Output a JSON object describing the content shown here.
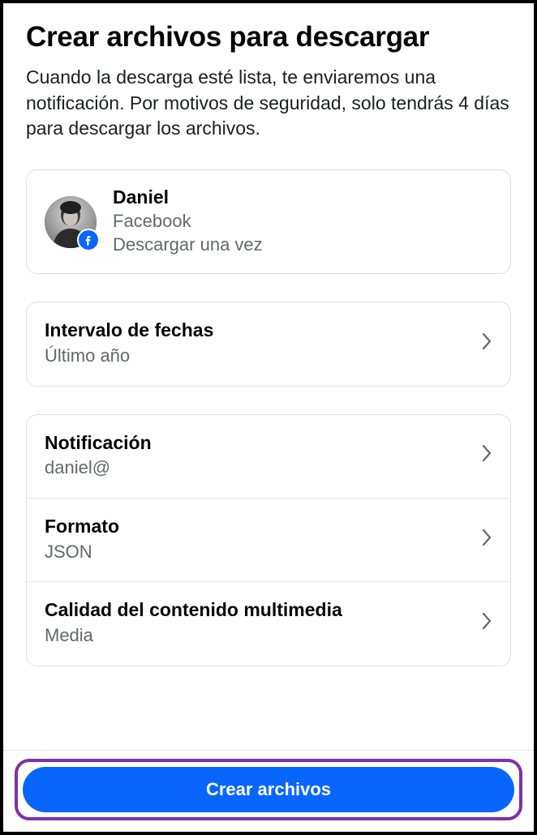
{
  "header": {
    "title": "Crear archivos para descargar",
    "description": "Cuando la descarga esté lista, te enviaremos una notificación. Por motivos de seguridad, solo tendrás 4 días para descargar los archivos."
  },
  "account": {
    "name": "Daniel",
    "platform": "Facebook",
    "mode": "Descargar una vez"
  },
  "dateRange": {
    "label": "Intervalo de fechas",
    "value": "Último año"
  },
  "settings": [
    {
      "label": "Notificación",
      "value": "daniel@"
    },
    {
      "label": "Formato",
      "value": "JSON"
    },
    {
      "label": "Calidad del contenido multimedia",
      "value": "Media"
    }
  ],
  "footer": {
    "primaryButton": "Crear archivos"
  }
}
